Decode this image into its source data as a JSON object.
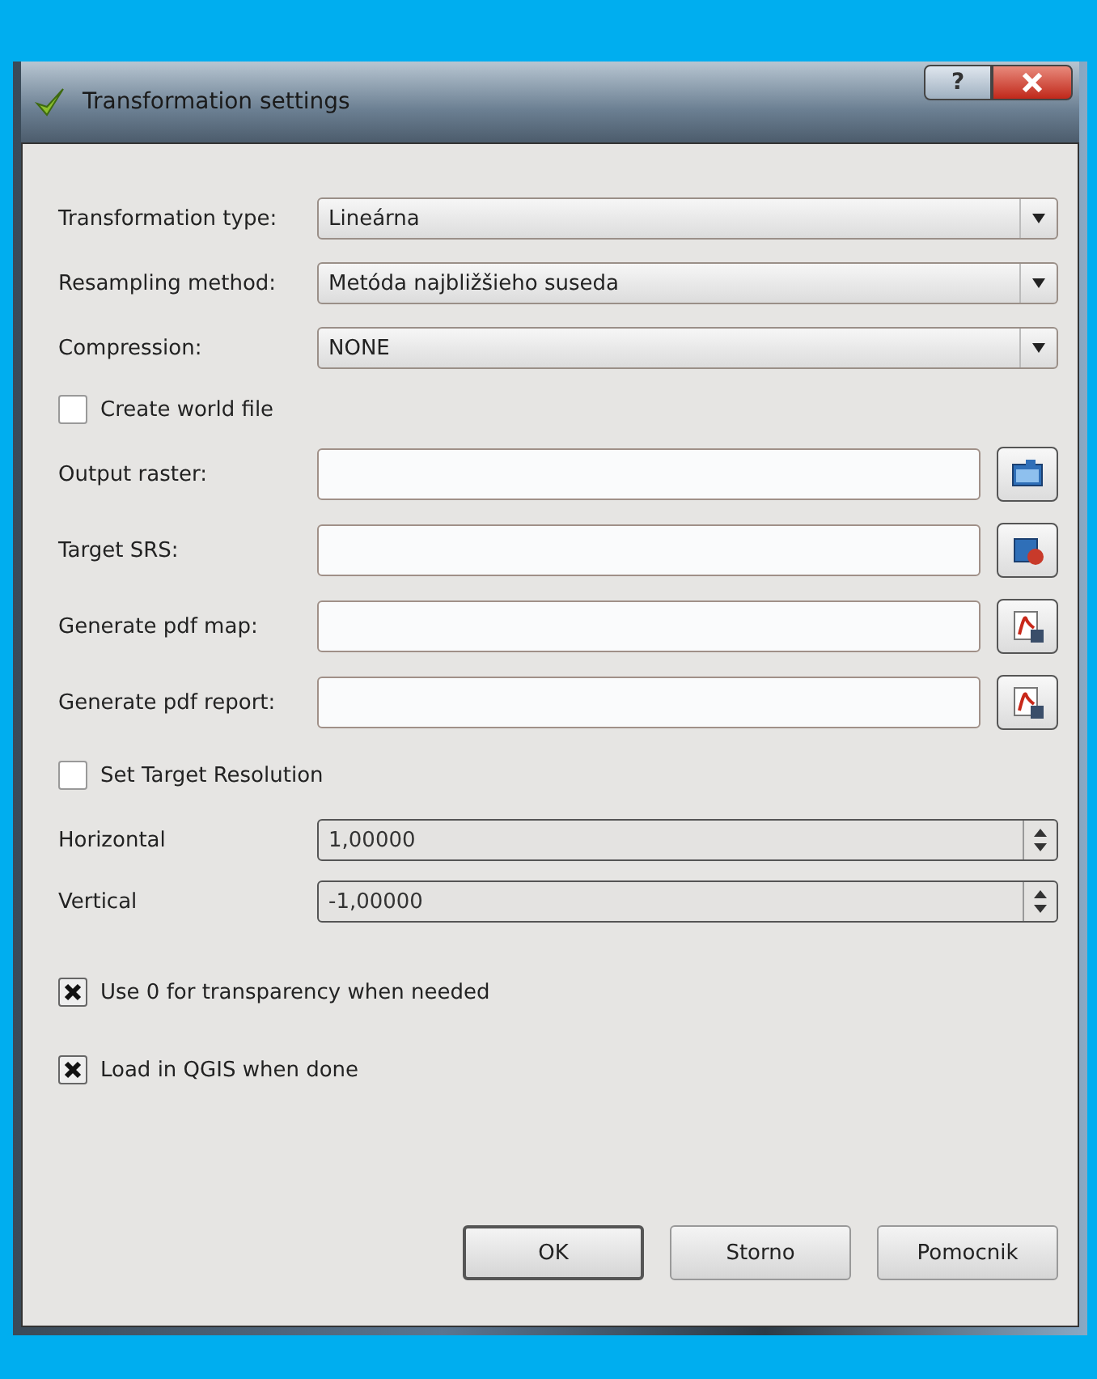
{
  "window": {
    "title": "Transformation settings",
    "help_button": "?"
  },
  "combos": [
    {
      "label": "Transformation type:",
      "value": "Lineárna"
    },
    {
      "label": "Resampling method:",
      "value": "Metóda najbližšieho suseda"
    },
    {
      "label": "Compression:",
      "value": "NONE"
    }
  ],
  "create_world_file": {
    "label": "Create world file",
    "checked": false
  },
  "file_fields": [
    {
      "label": "Output raster:",
      "kind": "folder"
    },
    {
      "label": "Target SRS:",
      "kind": "srs"
    },
    {
      "label": "Generate pdf map:",
      "kind": "pdf"
    },
    {
      "label": "Generate pdf report:",
      "kind": "pdf"
    }
  ],
  "target_resolution": {
    "label": "Set Target Resolution",
    "checked": false
  },
  "spin_fields": [
    {
      "label": "Horizontal",
      "value": "1,00000"
    },
    {
      "label": "Vertical",
      "value": "-1,00000"
    }
  ],
  "options": [
    {
      "label": "Use 0 for transparency when needed",
      "checked": true
    },
    {
      "label": "Load in QGIS when done",
      "checked": true
    }
  ],
  "buttons": [
    {
      "label": "OK",
      "default": true
    },
    {
      "label": "Storno",
      "default": false
    },
    {
      "label": "Pomocnik",
      "default": false
    }
  ]
}
